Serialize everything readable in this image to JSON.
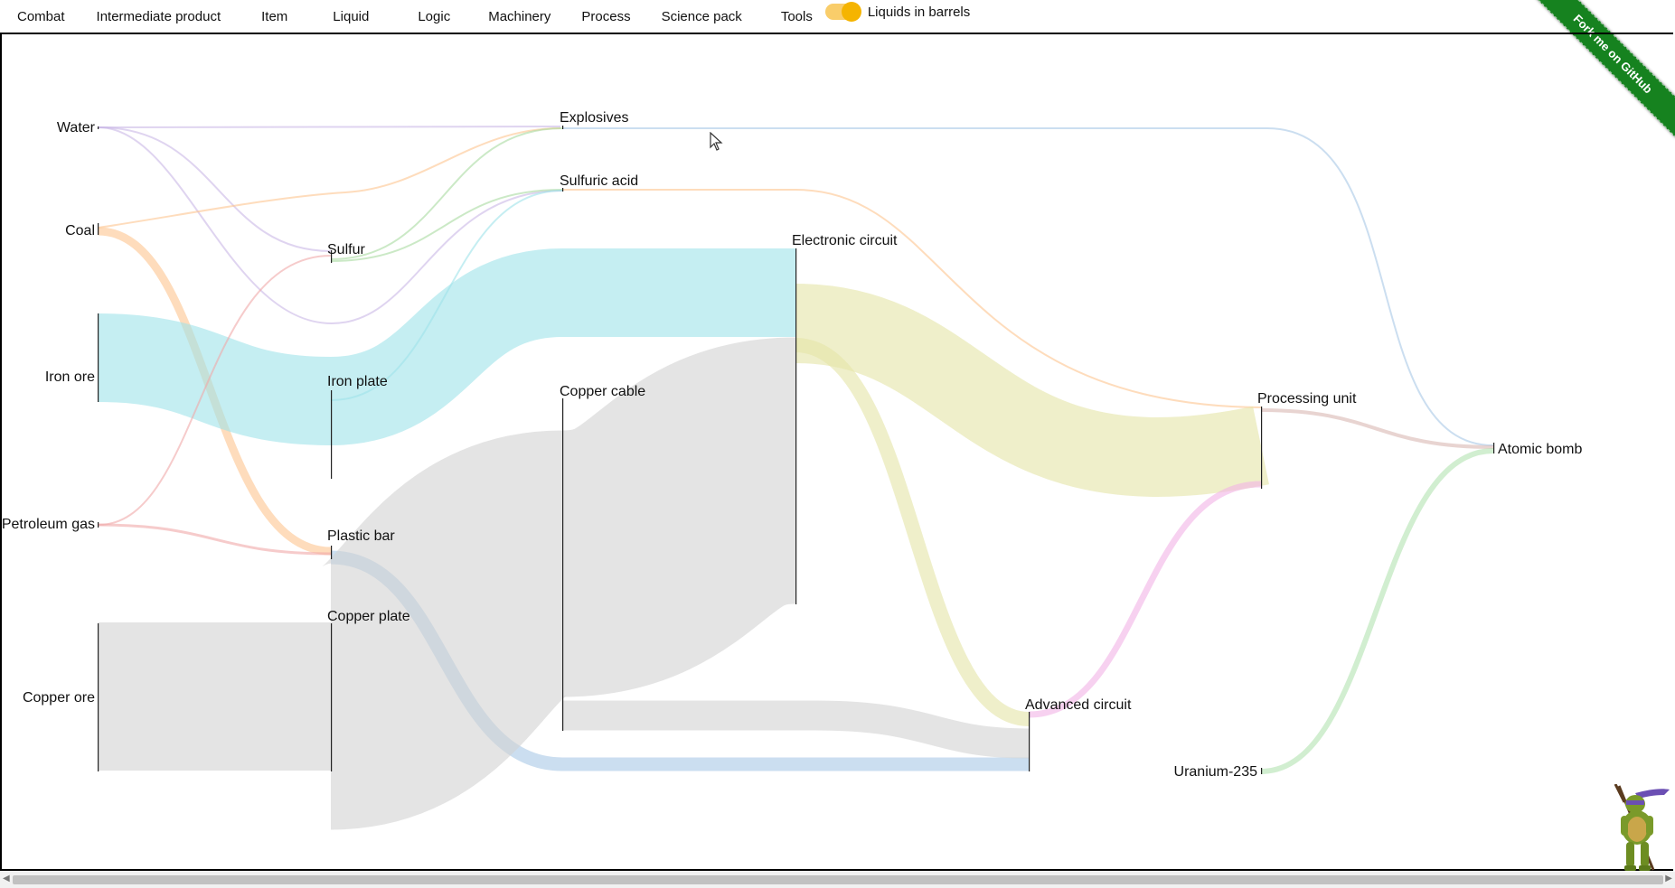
{
  "nav": {
    "items": [
      "Combat",
      "Intermediate product",
      "Item",
      "Liquid",
      "Logic",
      "Machinery",
      "Process",
      "Science pack",
      "Tools"
    ],
    "toggle_label": "Liquids in barrels",
    "toggle_on": true
  },
  "ribbon": {
    "text": "Fork me on GitHub"
  },
  "sankey": {
    "nodes": {
      "water": "Water",
      "coal": "Coal",
      "iron_ore": "Iron ore",
      "petroleum_gas": "Petroleum gas",
      "copper_ore": "Copper ore",
      "sulfur": "Sulfur",
      "iron_plate": "Iron plate",
      "plastic_bar": "Plastic bar",
      "copper_plate": "Copper plate",
      "explosives": "Explosives",
      "sulfuric_acid": "Sulfuric acid",
      "copper_cable": "Copper cable",
      "electronic_circuit": "Electronic circuit",
      "advanced_circuit": "Advanced circuit",
      "processing_unit": "Processing unit",
      "uranium_235": "Uranium-235",
      "atomic_bomb": "Atomic bomb"
    },
    "colors": {
      "water": "#c9b8e6",
      "coal": "#fdc58f",
      "iron": "#9ee3ea",
      "petroleum": "#f0a8a8",
      "copper": "#d2d2d2",
      "sulfur": "#a8dba0",
      "plastic": "#a9c8e6",
      "electronic": "#e4e4a6",
      "advanced": "#f2b3e6",
      "uranium": "#b3e2b0",
      "processing": "#d8b8b2"
    }
  }
}
